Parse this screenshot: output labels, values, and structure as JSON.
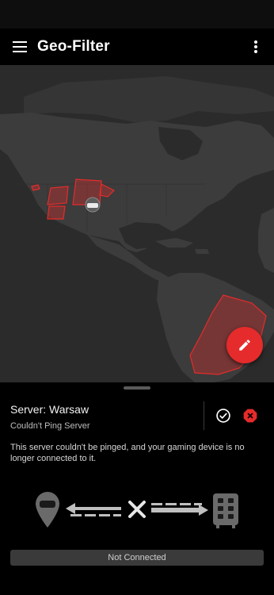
{
  "app_bar": {
    "title": "Geo-Filter",
    "menu_icon": "hamburger-menu-icon",
    "more_icon": "more-vert-icon"
  },
  "map": {
    "land_color": "#3a3a3a",
    "ocean_color": "#2b2b2b",
    "region_color": "#e52b2b",
    "user_marker_icon": "gamepad-icon"
  },
  "fab": {
    "icon": "pencil-icon",
    "color": "#e52b2b"
  },
  "server_panel": {
    "server_label": "Server: Warsaw",
    "status": "Couldn't Ping Server",
    "description": "This server couldn't be pinged, and your gaming device is no longer connected to it.",
    "allow_icon": "check-circle-icon",
    "block_icon": "block-octagon-icon",
    "connection_state_label": "Not Connected"
  }
}
